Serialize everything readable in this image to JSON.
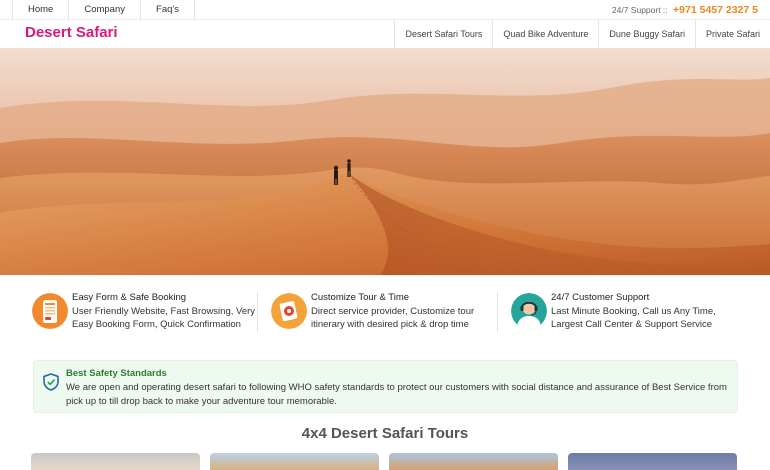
{
  "topbar": {
    "nav": [
      "Home",
      "Company",
      "Faq's"
    ],
    "support_label": "24/7 Support ::",
    "support_phone": "+971 5457 2327 5"
  },
  "header": {
    "logo": "Desert Safari",
    "nav": [
      "Desert Safari Tours",
      "Quad Bike Adventure",
      "Dune Buggy Safari",
      "Private Safari"
    ]
  },
  "hero": {
    "image": "desert-dunes-photo"
  },
  "features": [
    {
      "icon": "phone-form-icon",
      "title": "Easy Form & Safe Booking",
      "desc": "User Friendly Website, Fast Browsing, Very Easy Booking Form, Quick Confirmation"
    },
    {
      "icon": "customize-tour-icon",
      "title": "Customize Tour & Time",
      "desc": "Direct service provider, Customize tour itinerary with desired pick & drop time"
    },
    {
      "icon": "support-agent-icon",
      "title": "24/7 Customer Support",
      "desc": "Last Minute Booking, Call us Any Time, Largest Call Center & Support Service"
    }
  ],
  "safety": {
    "icon": "shield-check-icon",
    "title": "Best Safety Standards",
    "desc": "We are open and operating desert safari to following WHO safety standards to protect our customers with social distance and assurance of Best Service from pick up to till drop back to make your adventure tour memorable."
  },
  "section": {
    "title": "4x4 Desert Safari Tours"
  },
  "colors": {
    "brand": "#d91a77",
    "phone": "#e8891a",
    "safety_bg": "#eefaef",
    "safety_title": "#2e7d32"
  }
}
